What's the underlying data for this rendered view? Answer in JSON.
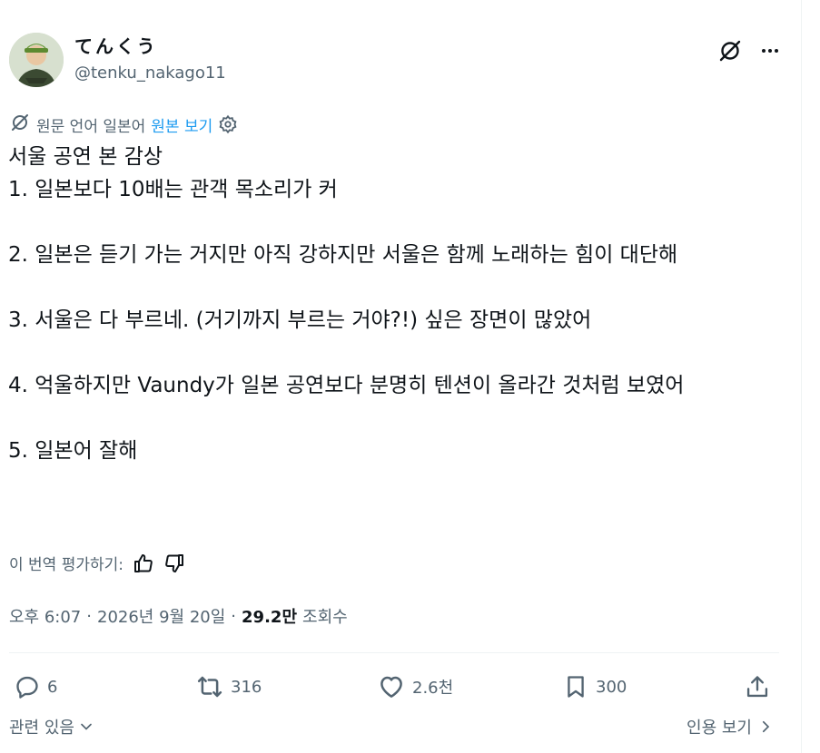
{
  "author": {
    "display_name": "てんくう",
    "handle": "@tenku_nakago11"
  },
  "translation": {
    "source_label": "원문 언어 일본어",
    "show_original": "원본 보기"
  },
  "tweet": {
    "text": "서울 공연 본 감상\n1. 일본보다 10배는 관객 목소리가 커\n\n2. 일본은 듣기 가는 거지만 아직 강하지만 서울은 함께 노래하는 힘이 대단해\n\n3. 서울은 다 부르네. (거기까지 부르는 거야?!) 싶은 장면이 많았어\n\n4. 억울하지만 Vaundy가 일본 공연보다 분명히 텐션이 올라간 것처럼 보였어\n\n5. 일본어 잘해"
  },
  "rate": {
    "label": "이 번역 평가하기:"
  },
  "meta": {
    "time": "오후 6:07",
    "date": "2026년 9월 20일",
    "views_count": "29.2만",
    "views_label": "조회수",
    "separator": "·"
  },
  "actions": {
    "reply_count": "6",
    "retweet_count": "316",
    "like_count": "2.6천",
    "bookmark_count": "300"
  },
  "footer": {
    "related": "관련 있음",
    "quotes": "인용 보기"
  },
  "colors": {
    "text": "#0f1419",
    "secondary": "#536471",
    "link": "#1d9bf0",
    "divider": "#eff3f4"
  },
  "icons": [
    "translate-off-icon",
    "more-icon",
    "gear-icon",
    "thumbs-up-icon",
    "thumbs-down-icon",
    "reply-icon",
    "retweet-icon",
    "like-icon",
    "bookmark-icon",
    "share-icon",
    "chevron-down-icon",
    "chevron-right-icon"
  ]
}
